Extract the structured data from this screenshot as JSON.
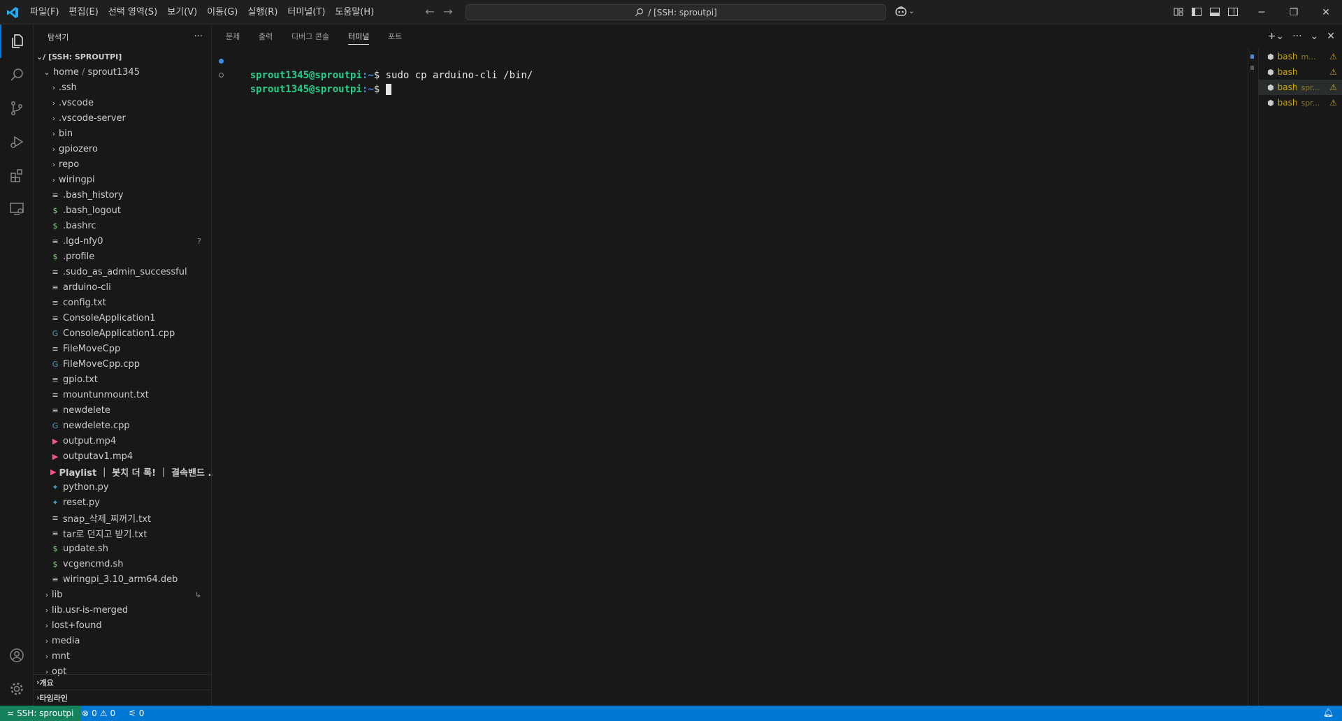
{
  "menu": [
    "파일(F)",
    "편집(E)",
    "선택 영역(S)",
    "보기(V)",
    "이동(G)",
    "실행(R)",
    "터미널(T)",
    "도움말(H)"
  ],
  "command_center": "/ [SSH: sproutpi]",
  "sidebar": {
    "title": "탐색기",
    "more": "···",
    "root": "/ [SSH: SPROUTPI]",
    "home": "home",
    "user": "sprout1345",
    "folders": [
      ".ssh",
      ".vscode",
      ".vscode-server",
      "bin",
      "gpiozero",
      "repo",
      "wiringpi"
    ],
    "files": [
      {
        "name": ".bash_history",
        "icon": "≡",
        "color": "#cccccc"
      },
      {
        "name": ".bash_logout",
        "icon": "$",
        "color": "#89d185"
      },
      {
        "name": ".bashrc",
        "icon": "$",
        "color": "#89d185"
      },
      {
        "name": ".lgd-nfy0",
        "icon": "≡",
        "color": "#cccccc",
        "badge": "?"
      },
      {
        "name": ".profile",
        "icon": "$",
        "color": "#89d185"
      },
      {
        "name": ".sudo_as_admin_successful",
        "icon": "≡",
        "color": "#cccccc"
      },
      {
        "name": "arduino-cli",
        "icon": "≡",
        "color": "#cccccc"
      },
      {
        "name": "config.txt",
        "icon": "≡",
        "color": "#cccccc"
      },
      {
        "name": "ConsoleApplication1",
        "icon": "≡",
        "color": "#cccccc"
      },
      {
        "name": "ConsoleApplication1.cpp",
        "icon": "G",
        "color": "#519aba"
      },
      {
        "name": "FileMoveCpp",
        "icon": "≡",
        "color": "#cccccc"
      },
      {
        "name": "FileMoveCpp.cpp",
        "icon": "G",
        "color": "#519aba"
      },
      {
        "name": "gpio.txt",
        "icon": "≡",
        "color": "#cccccc"
      },
      {
        "name": "mountunmount.txt",
        "icon": "≡",
        "color": "#cccccc"
      },
      {
        "name": "newdelete",
        "icon": "≡",
        "color": "#cccccc"
      },
      {
        "name": "newdelete.cpp",
        "icon": "G",
        "color": "#519aba"
      },
      {
        "name": "output.mp4",
        "icon": "▶",
        "color": "#f55385"
      },
      {
        "name": "outputav1.mp4",
        "icon": "▶",
        "color": "#f55385"
      },
      {
        "name": "Playlist ｜ 봇치 더 록! ｜ 결속밴드 ...",
        "icon": "▶",
        "color": "#f55385",
        "bold": true
      },
      {
        "name": "python.py",
        "icon": "✦",
        "color": "#519aba"
      },
      {
        "name": "reset.py",
        "icon": "✦",
        "color": "#519aba"
      },
      {
        "name": "snap_삭제_찌꺼기.txt",
        "icon": "≡",
        "color": "#cccccc"
      },
      {
        "name": "tar로 던지고 받기.txt",
        "icon": "≡",
        "color": "#cccccc"
      },
      {
        "name": "update.sh",
        "icon": "$",
        "color": "#89d185"
      },
      {
        "name": "vcgencmd.sh",
        "icon": "$",
        "color": "#89d185"
      },
      {
        "name": "wiringpi_3.10_arm64.deb",
        "icon": "≡",
        "color": "#cccccc"
      }
    ],
    "root_folders": [
      {
        "name": "lib",
        "badge": "↳"
      },
      {
        "name": "lib.usr-is-merged"
      },
      {
        "name": "lost+found"
      },
      {
        "name": "media"
      },
      {
        "name": "mnt"
      },
      {
        "name": "opt"
      }
    ],
    "outline": "개요",
    "timeline": "타임라인"
  },
  "panel": {
    "tabs": [
      "문제",
      "출력",
      "디버그 콘솔",
      "터미널",
      "포트"
    ],
    "active_tab": "터미널"
  },
  "terminal": {
    "user": "sprout1345@sproutpi",
    "path": ":~",
    "dollar": "$ ",
    "lines": [
      {
        "command": "sudo cp arduino-cli /bin/"
      },
      {
        "command": ""
      }
    ]
  },
  "terminal_list": [
    {
      "name": "bash",
      "desc": "m..."
    },
    {
      "name": "bash",
      "desc": ""
    },
    {
      "name": "bash",
      "desc": "spr..."
    },
    {
      "name": "bash",
      "desc": "spr..."
    }
  ],
  "status": {
    "remote": "SSH: sproutpi",
    "errors": "0",
    "warnings": "0",
    "ports": "0"
  }
}
